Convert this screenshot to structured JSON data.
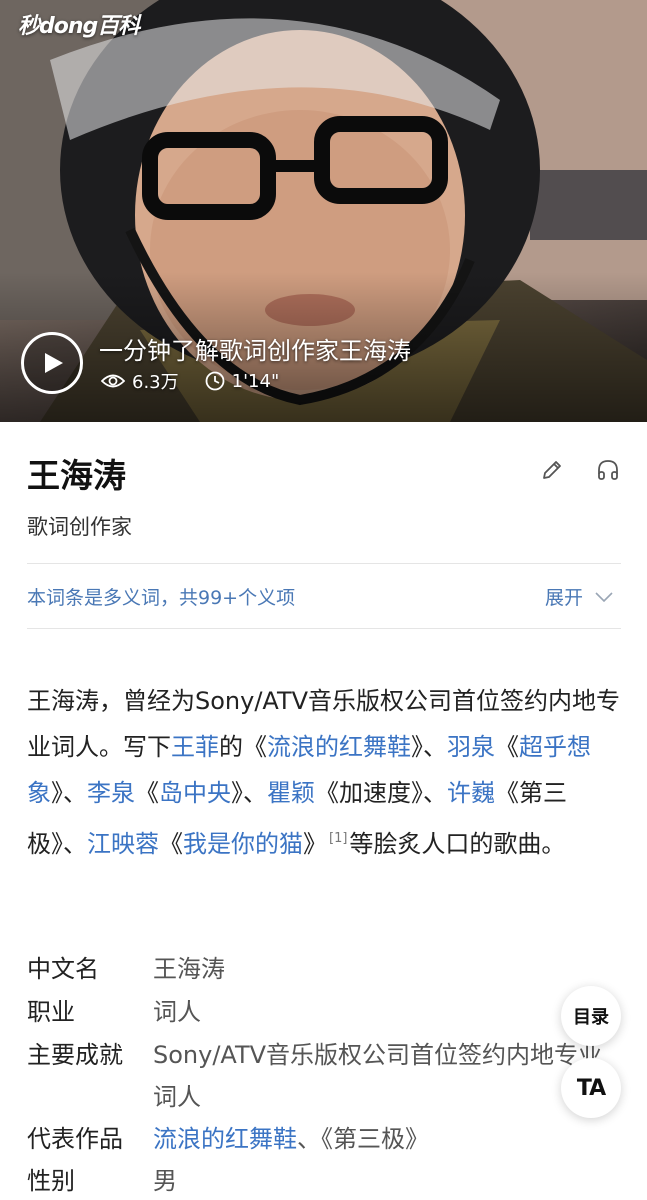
{
  "hero": {
    "logo_text": "秒dong百科",
    "video_title": "一分钟了解歌词创作家王海涛",
    "views": "6.3万",
    "duration": "1'14\""
  },
  "entry": {
    "title": "王海涛",
    "subtitle": "歌词创作家"
  },
  "polysemy": {
    "text": "本词条是多义词，共99+个义项",
    "expand_label": "展开"
  },
  "summary": {
    "p1": "王海涛，曾经为Sony/ATV音乐版权公司首位签约内地专业词人。写下",
    "link_wangfei": "王菲",
    "p2": "的《",
    "link_song1": "流浪的红舞鞋",
    "p3": "》、",
    "link_yuquan": "羽泉",
    "p4": "《",
    "link_song2": "超乎想象",
    "p5": "》、",
    "link_liquan": "李泉",
    "p6": "《",
    "link_song3": "岛中央",
    "p7": "》、",
    "link_quying": "瞿颖",
    "p8": "《加速度》、",
    "link_xuwei": "许巍",
    "p9": "《第三极》、",
    "link_jiangyingrong": "江映蓉",
    "p10": "《",
    "link_song4": "我是你的猫",
    "p11": "》",
    "ref": "[1]",
    "p12": "等脍炙人口的歌曲。"
  },
  "info": [
    {
      "key": "中文名",
      "value": "王海涛"
    },
    {
      "key": "职业",
      "value": "词人"
    },
    {
      "key": "主要成就",
      "value": "Sony/ATV音乐版权公司首位签约内地专业词人"
    },
    {
      "key": "代表作品",
      "link": "流浪的红舞鞋",
      "rest": "、《第三极》"
    },
    {
      "key": "性别",
      "value": "男"
    }
  ],
  "floating": {
    "toc_label": "目录",
    "font_label": "TA"
  },
  "colors": {
    "link": "#3b74c4",
    "polysemy_link": "#4a78b5"
  }
}
